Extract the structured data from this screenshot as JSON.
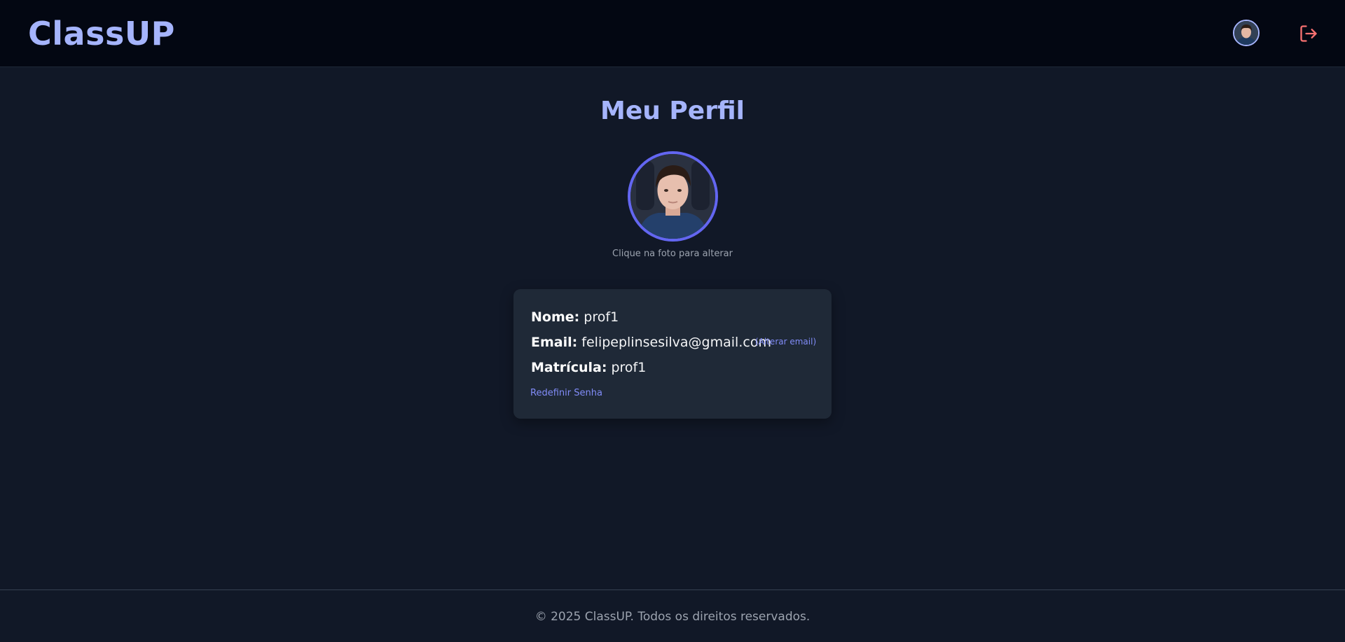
{
  "header": {
    "logo": "ClassUP",
    "avatar_icon": "user-avatar",
    "logout_icon": "logout-icon",
    "logout_color": "#f87171"
  },
  "profile": {
    "title": "Meu Perfil",
    "photo_hint": "Clique na foto para alterar",
    "name_label": "Nome:",
    "name_value": "prof1",
    "email_label": "Email:",
    "email_value": "felipeplinsesilva@gmail.com",
    "change_email": "(Alterar email)",
    "matricula_label": "Matrícula:",
    "matricula_value": "prof1",
    "reset_password": "Redefinir Senha"
  },
  "footer": {
    "text": "© 2025 ClassUP. Todos os direitos reservados."
  },
  "colors": {
    "accent": "#a5b4fc",
    "photo_ring": "#6366f1",
    "link": "#818cf8",
    "background": "#111827",
    "card": "#1f2937",
    "header": "#030712"
  }
}
